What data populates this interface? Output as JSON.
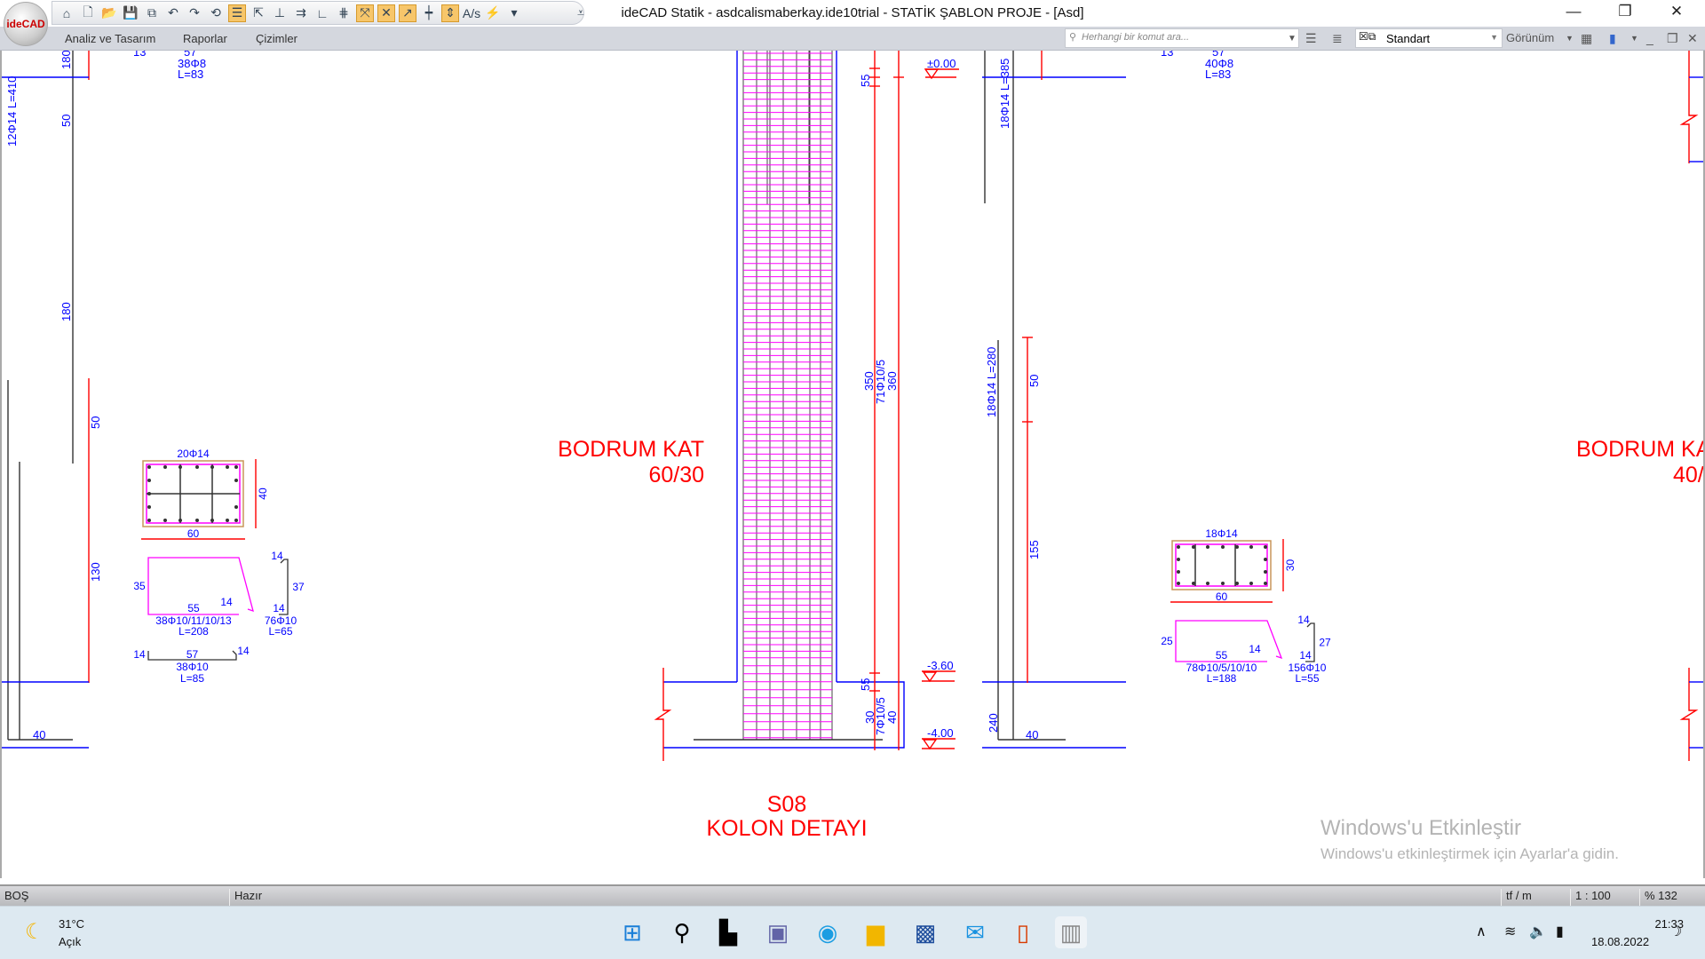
{
  "app": {
    "title": "ideCAD Statik - asdcalismaberkay.ide10trial - STATİK ŞABLON PROJE - [Asd]",
    "logo": "ideCAD"
  },
  "menu": [
    "Analiz ve Tasarım",
    "Raporlar",
    "Çizimler"
  ],
  "search": {
    "placeholder": "Herhangi bir komut ara..."
  },
  "style_select": {
    "value": "Standart"
  },
  "view_menu": "Görünüm",
  "status": {
    "left": "BOŞ",
    "message": "Hazır",
    "unit": "tf / m",
    "scale": "1 : 100",
    "zoom": "% 132"
  },
  "taskbar": {
    "temp": "31°C",
    "weather": "Açık",
    "time": "21:33",
    "date": "18.08.2022"
  },
  "watermark": {
    "line1": "Windows'u Etkinleştir",
    "line2": "Windows'u etkinleştirmek için Ayarlar'a gidin."
  },
  "colors": {
    "dim": "#ff0000",
    "text": "#0000ff",
    "rebar": "#ff00ff",
    "concrete": "#0000ff",
    "cover": "#c8965a"
  },
  "drawing": {
    "left": {
      "bar_label": "12Φ14  L=410",
      "d180a": "180",
      "d50a": "50",
      "d180b": "180",
      "d50b": "50",
      "d130": "130",
      "d40": "40",
      "top_s1": "13",
      "top_s2": "57",
      "top_lbl": "38Φ8",
      "top_len": "L=83",
      "sec_bars": "20Φ14",
      "sec_h": "40",
      "sec_w": "60",
      "st_h": "35",
      "st_w": "55",
      "st_hook": "14",
      "st_lbl": "38Φ10/11/10/13",
      "st_len": "L=208",
      "hk_a": "14",
      "hk_h": "37",
      "hk_b": "14",
      "hk_lbl": "76Φ10",
      "hk_len": "L=65",
      "bt_a": "14",
      "bt_w": "57",
      "bt_b": "14",
      "bt_lbl": "38Φ10",
      "bt_len": "L=85"
    },
    "center": {
      "title1": "BODRUM KAT",
      "title2": "60/30",
      "d55a": "55",
      "d350": "350",
      "stir": "71Φ10/5",
      "d360": "360",
      "d55b": "55",
      "d30": "30",
      "stir2": "7Φ10/5",
      "d40": "40",
      "lvl0": "±0.00",
      "lvl1": "-3.60",
      "lvl2": "-4.00",
      "caption1": "S08",
      "caption2": "KOLON DETAYI"
    },
    "right": {
      "bar_top": "18Φ14  L=385",
      "bar_low": "18Φ14  L=280",
      "d50": "50",
      "d155": "155",
      "d240": "240",
      "d40": "40",
      "top_s1": "13",
      "top_s2": "57",
      "top_lbl": "40Φ8",
      "top_len": "L=83",
      "sec_bars": "18Φ14",
      "sec_h": "30",
      "sec_w": "60",
      "st_h": "25",
      "st_w": "55",
      "st_hook": "14",
      "st_lbl": "78Φ10/5/10/10",
      "st_len": "L=188",
      "hk_a": "14",
      "hk_h": "27",
      "hk_b": "14",
      "hk_lbl": "156Φ10",
      "hk_len": "L=55",
      "title1": "BODRUM KA",
      "title2": "40/"
    }
  }
}
